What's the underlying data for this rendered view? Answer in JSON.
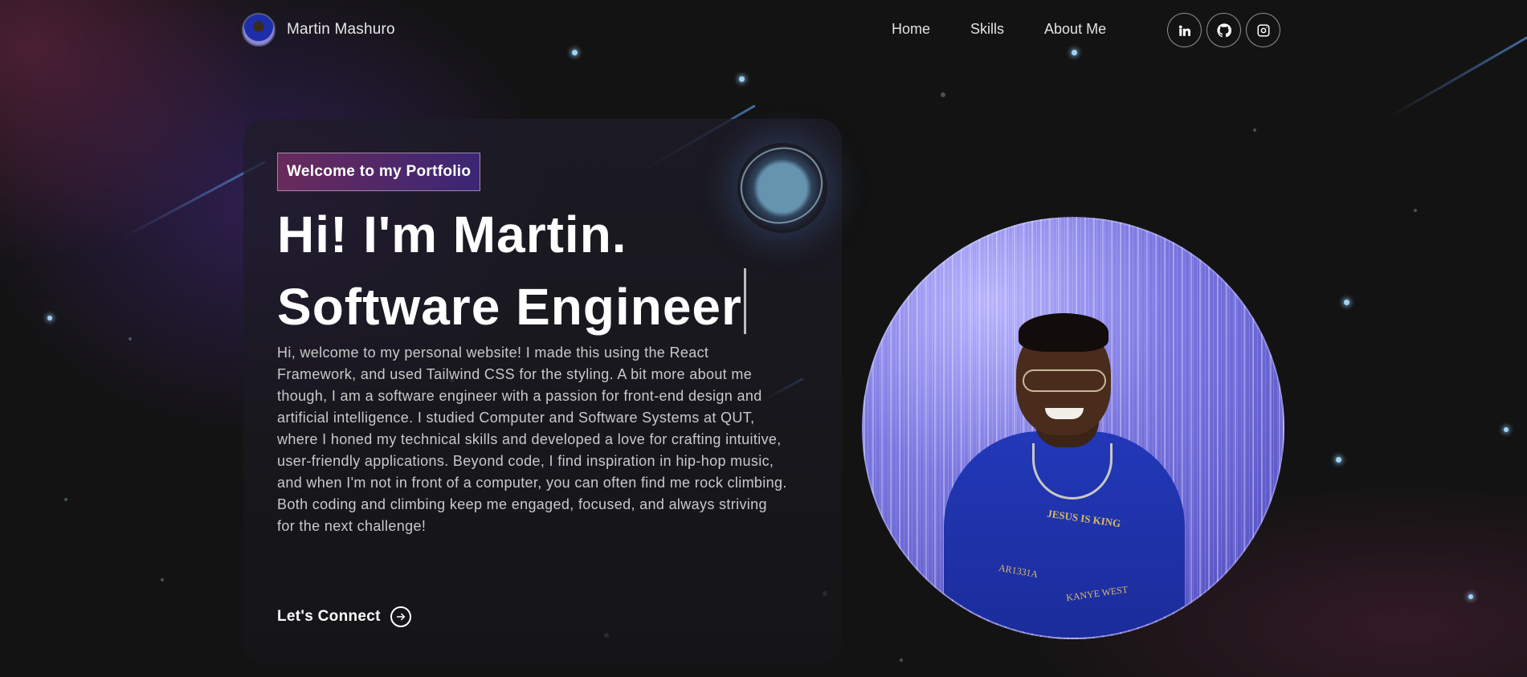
{
  "header": {
    "brand_name": "Martin Mashuro",
    "nav": [
      {
        "label": "Home"
      },
      {
        "label": "Skills"
      },
      {
        "label": "About Me"
      }
    ],
    "socials": [
      {
        "name": "linkedin-icon"
      },
      {
        "name": "github-icon"
      },
      {
        "name": "instagram-icon"
      }
    ]
  },
  "hero": {
    "tagline": "Welcome to my Portfolio",
    "headline_line1": "Hi! I'm Martin.",
    "headline_line2": "Software Engineer",
    "bio": "Hi, welcome to my personal website! I made this using the React Framework, and used Tailwind CSS for the styling. A bit more about me though, I am a software engineer with a passion for front-end design and artificial intelligence. I studied Computer and Software Systems at QUT, where I honed my technical skills and developed a love for crafting intuitive, user-friendly applications. Beyond code, I find inspiration in hip-hop music, and when I'm not in front of a computer, you can often find me rock climbing. Both coding and climbing keep me engaged, focused, and always striving for the next challenge!",
    "cta_label": "Let's Connect",
    "cta_icon": "arrow-right-circle-icon"
  },
  "portrait": {
    "hoodie_text_1": "JESUS IS KING",
    "hoodie_text_2": "AR1331A",
    "hoodie_text_3": "KANYE WEST"
  },
  "colors": {
    "background": "#121212",
    "tagline_gradient_start": "#aa367c",
    "tagline_gradient_end": "#4a2fbd",
    "text": "#ffffff",
    "muted_text": "#c9c9c9"
  }
}
